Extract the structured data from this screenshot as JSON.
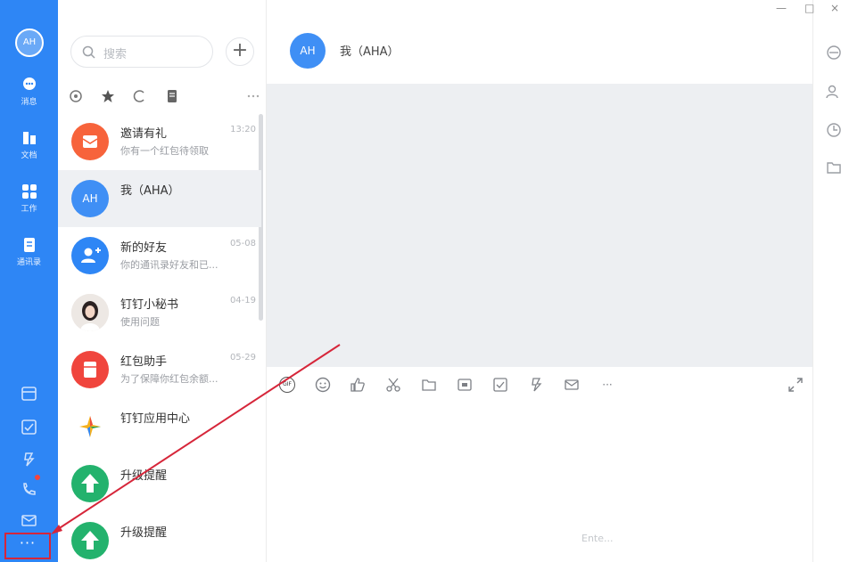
{
  "window": {
    "minimize_glyph": "—",
    "maximize_glyph": "□",
    "close_glyph": "×"
  },
  "rail": {
    "avatar_text": "AH",
    "items": [
      {
        "label": "消息",
        "icon": "message-icon"
      },
      {
        "label": "文档",
        "icon": "document-icon"
      },
      {
        "label": "工作",
        "icon": "apps-grid-icon"
      },
      {
        "label": "通讯录",
        "icon": "contacts-icon"
      }
    ],
    "more_label": "···"
  },
  "list": {
    "search_placeholder": "搜索",
    "add_label": "+",
    "conversations": [
      {
        "name": "邀请有礼",
        "preview": "你有一个红包待领取",
        "time": "13:20",
        "avatar_color": "#f7633b",
        "avatar_icon": "gift-mail-icon"
      },
      {
        "name": "我（AHA）",
        "preview": "",
        "time": "",
        "avatar_color": "#3f8ff5",
        "avatar_text": "AH"
      },
      {
        "name": "新的好友",
        "preview": "你的通讯录好友和已...",
        "time": "05-08",
        "avatar_color": "#2e86f5",
        "avatar_icon": "add-friend-icon"
      },
      {
        "name": "钉钉小秘书",
        "preview": "使用问题",
        "time": "04-19",
        "avatar_color": "#c9cdd4",
        "avatar_icon": "person-photo-icon"
      },
      {
        "name": "红包助手",
        "preview": "为了保障你红包余额...",
        "time": "05-29",
        "avatar_color": "#f0453d",
        "avatar_icon": "red-packet-icon"
      },
      {
        "name": "钉钉应用中心",
        "preview": "",
        "time": "",
        "avatar_color": "#ffffff",
        "avatar_icon": "app-center-icon"
      },
      {
        "name": "升级提醒",
        "preview": "",
        "time": "",
        "avatar_color": "#23b26d",
        "avatar_icon": "upgrade-arrow-icon"
      },
      {
        "name": "升级提醒",
        "preview": "",
        "time": "",
        "avatar_color": "#23b26d",
        "avatar_icon": "upgrade-arrow-icon"
      }
    ]
  },
  "chat": {
    "avatar_text": "AH",
    "title": "我（AHA）",
    "toolbar": {
      "gif": "GIF",
      "more": "···"
    },
    "send_hint": "Ente..."
  },
  "colors": {
    "rail": "#2e86f5",
    "highlight_box": "#d6263a",
    "annotation_arrow": "#d6263a"
  }
}
